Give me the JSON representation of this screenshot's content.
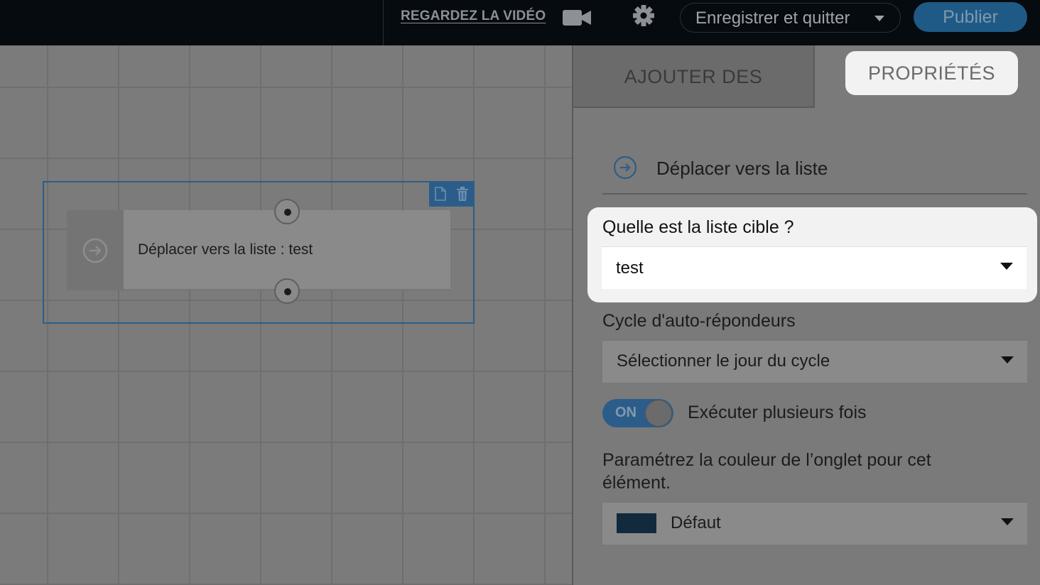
{
  "topbar": {
    "video_link": "REGARDEZ LA VIDÉO",
    "video_icon": "video-camera-icon",
    "settings_icon": "gear-icon",
    "save_button": "Enregistrer et quitter",
    "publish_button": "Publier"
  },
  "canvas": {
    "node": {
      "label": "Déplacer vers la liste : test",
      "icon": "arrow-circle-icon",
      "tool_icons": [
        "document-icon",
        "trash-icon"
      ]
    }
  },
  "panel": {
    "tabs": {
      "add": "AJOUTER DES",
      "properties": "PROPRIÉTÉS"
    },
    "action_title": "Déplacer vers la liste",
    "target_list": {
      "label": "Quelle est la liste cible ?",
      "value": "test"
    },
    "cycle": {
      "label": "Cycle d'auto-répondeurs",
      "value": "Sélectionner le jour du cycle"
    },
    "repeat": {
      "toggle_state": "ON",
      "label": "Exécuter plusieurs fois"
    },
    "tab_color": {
      "label": "Paramétrez la couleur de l’onglet pour cet élément.",
      "value": "Défaut",
      "swatch": "#13293d"
    }
  },
  "colors": {
    "accent": "#2c5d8a",
    "topbar": "#060b10",
    "highlight": "#f2f2f2"
  }
}
